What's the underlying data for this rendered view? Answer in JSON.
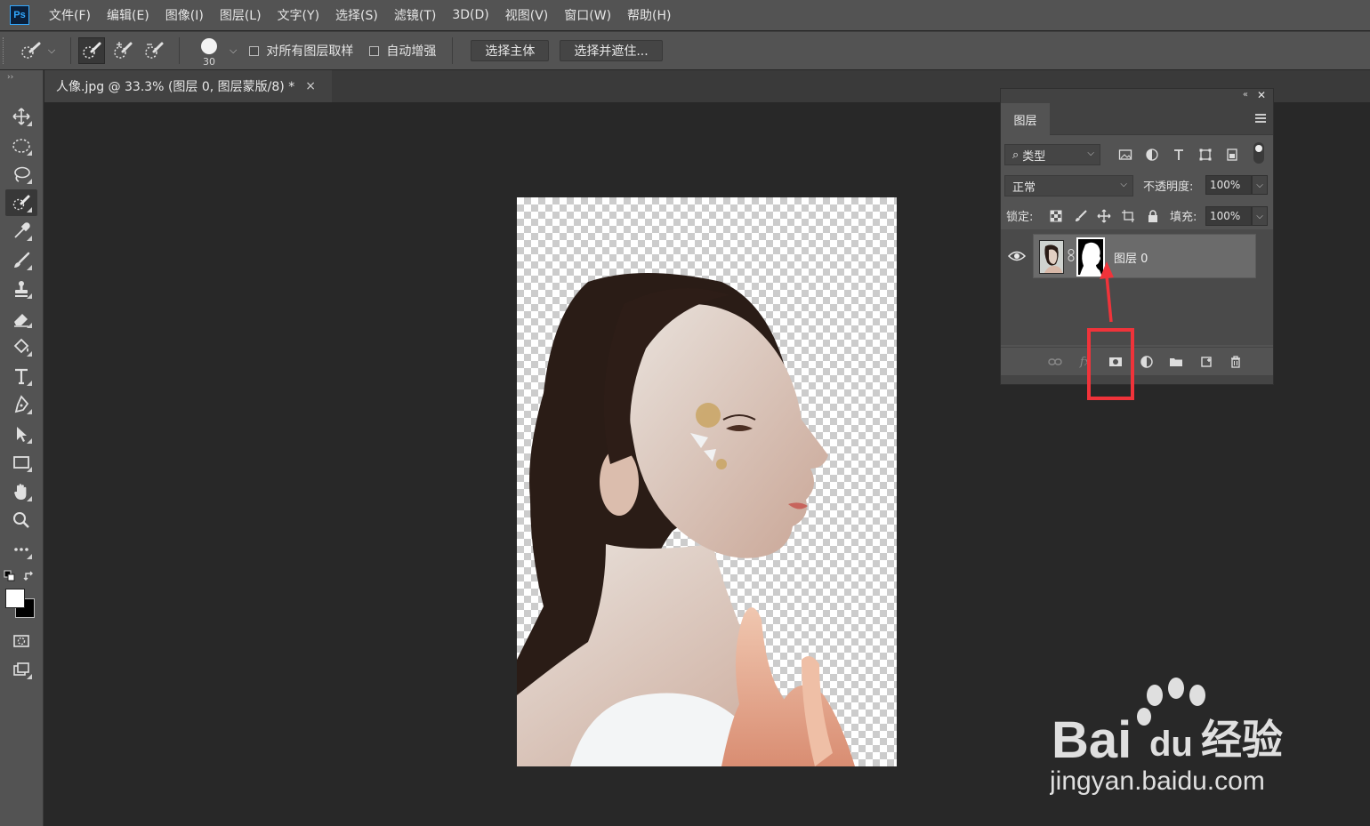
{
  "app": {
    "logo": "Ps"
  },
  "menu": [
    "文件(F)",
    "编辑(E)",
    "图像(I)",
    "图层(L)",
    "文字(Y)",
    "选择(S)",
    "滤镜(T)",
    "3D(D)",
    "视图(V)",
    "窗口(W)",
    "帮助(H)"
  ],
  "options": {
    "brush_size": "30",
    "sample_all_layers": "对所有图层取样",
    "auto_enhance": "自动增强",
    "select_subject": "选择主体",
    "select_and_mask": "选择并遮住..."
  },
  "document_tab": {
    "title": "人像.jpg @ 33.3% (图层 0, 图层蒙版/8) *",
    "close": "×"
  },
  "layers_panel": {
    "tab": "图层",
    "filter": "类型",
    "blend_mode": "正常",
    "opacity_label": "不透明度:",
    "opacity": "100%",
    "lock_label": "锁定:",
    "fill_label": "填充:",
    "fill": "100%",
    "layers": [
      {
        "name": "图层 0",
        "visible": true,
        "has_mask": true
      }
    ]
  },
  "colors": {
    "foreground": "#ffffff",
    "background": "#000000",
    "annotation": "#f0333a",
    "accent": "#31a8ff"
  },
  "watermark": {
    "brand": "Bai",
    "brand_du": "du",
    "brand_cn": "经验",
    "url": "jingyan.baidu.com"
  }
}
